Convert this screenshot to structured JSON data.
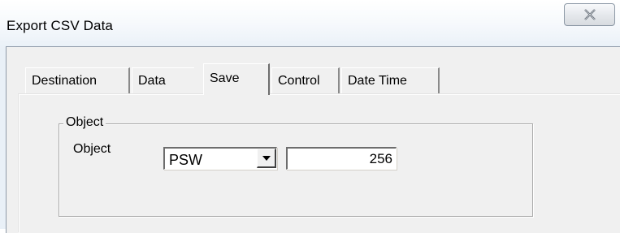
{
  "window": {
    "title": "Export CSV Data",
    "close_icon": "close-icon"
  },
  "tabs": [
    {
      "label": "Destination",
      "active": false
    },
    {
      "label": "Data",
      "active": false
    },
    {
      "label": "Save",
      "active": true
    },
    {
      "label": "Control",
      "active": false
    },
    {
      "label": "Date Time",
      "active": false
    }
  ],
  "object_group": {
    "legend": "Object",
    "field_label": "Object",
    "device_type": {
      "value": "PSW"
    },
    "address": {
      "value": "256"
    }
  }
}
